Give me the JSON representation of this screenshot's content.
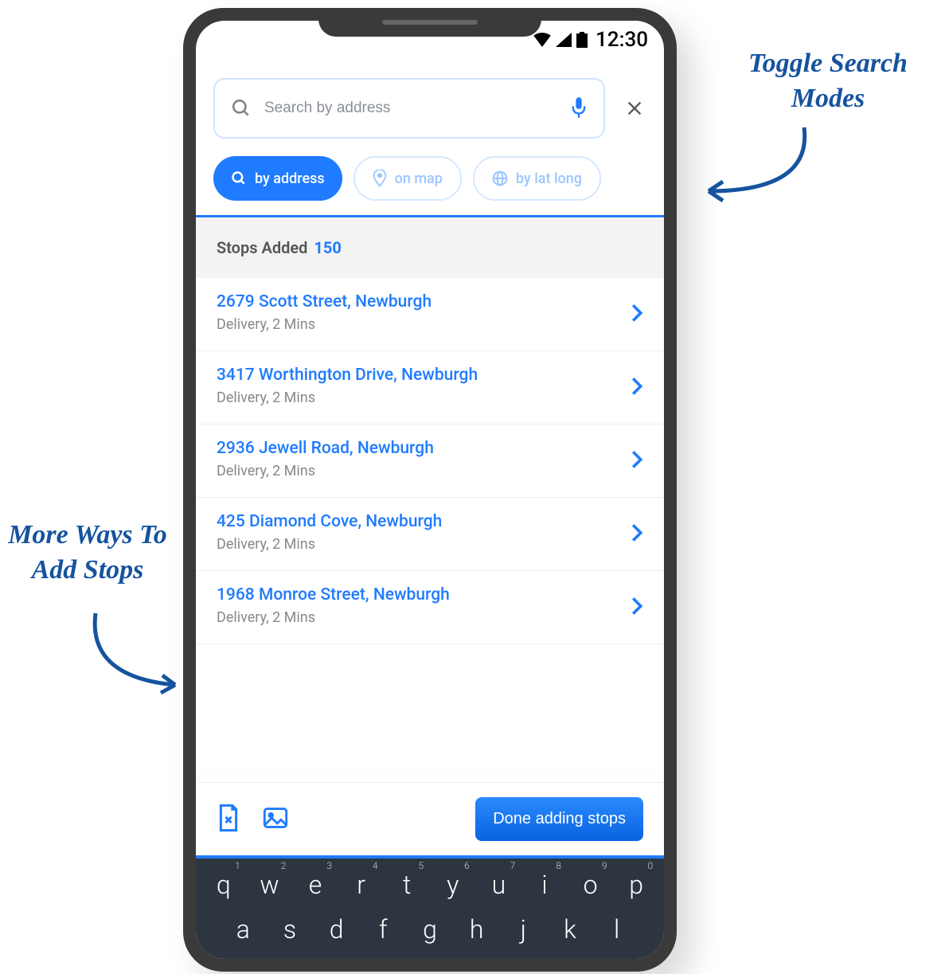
{
  "status": {
    "time": "12:30"
  },
  "search": {
    "placeholder": "Search by address",
    "value": ""
  },
  "modes": {
    "by_address": "by address",
    "on_map": "on map",
    "by_latlong": "by lat long"
  },
  "stops_header": {
    "label": "Stops Added",
    "count": "150"
  },
  "stops": [
    {
      "address": "2679 Scott Street, Newburgh",
      "meta": "Delivery, 2 Mins"
    },
    {
      "address": "3417 Worthington Drive, Newburgh",
      "meta": "Delivery, 2 Mins"
    },
    {
      "address": "2936 Jewell Road, Newburgh",
      "meta": "Delivery, 2 Mins"
    },
    {
      "address": "425 Diamond Cove, Newburgh",
      "meta": "Delivery, 2 Mins"
    },
    {
      "address": "1968 Monroe Street, Newburgh",
      "meta": "Delivery, 2 Mins"
    }
  ],
  "bottom": {
    "done": "Done adding stops"
  },
  "keyboard": {
    "row1": [
      {
        "k": "q",
        "n": "1"
      },
      {
        "k": "w",
        "n": "2"
      },
      {
        "k": "e",
        "n": "3"
      },
      {
        "k": "r",
        "n": "4"
      },
      {
        "k": "t",
        "n": "5"
      },
      {
        "k": "y",
        "n": "6"
      },
      {
        "k": "u",
        "n": "7"
      },
      {
        "k": "i",
        "n": "8"
      },
      {
        "k": "o",
        "n": "9"
      },
      {
        "k": "p",
        "n": "0"
      }
    ],
    "row2": [
      "a",
      "s",
      "d",
      "f",
      "g",
      "h",
      "j",
      "k",
      "l"
    ]
  },
  "annotations": {
    "left": "More Ways To Add Stops",
    "right": "Toggle Search Modes"
  }
}
